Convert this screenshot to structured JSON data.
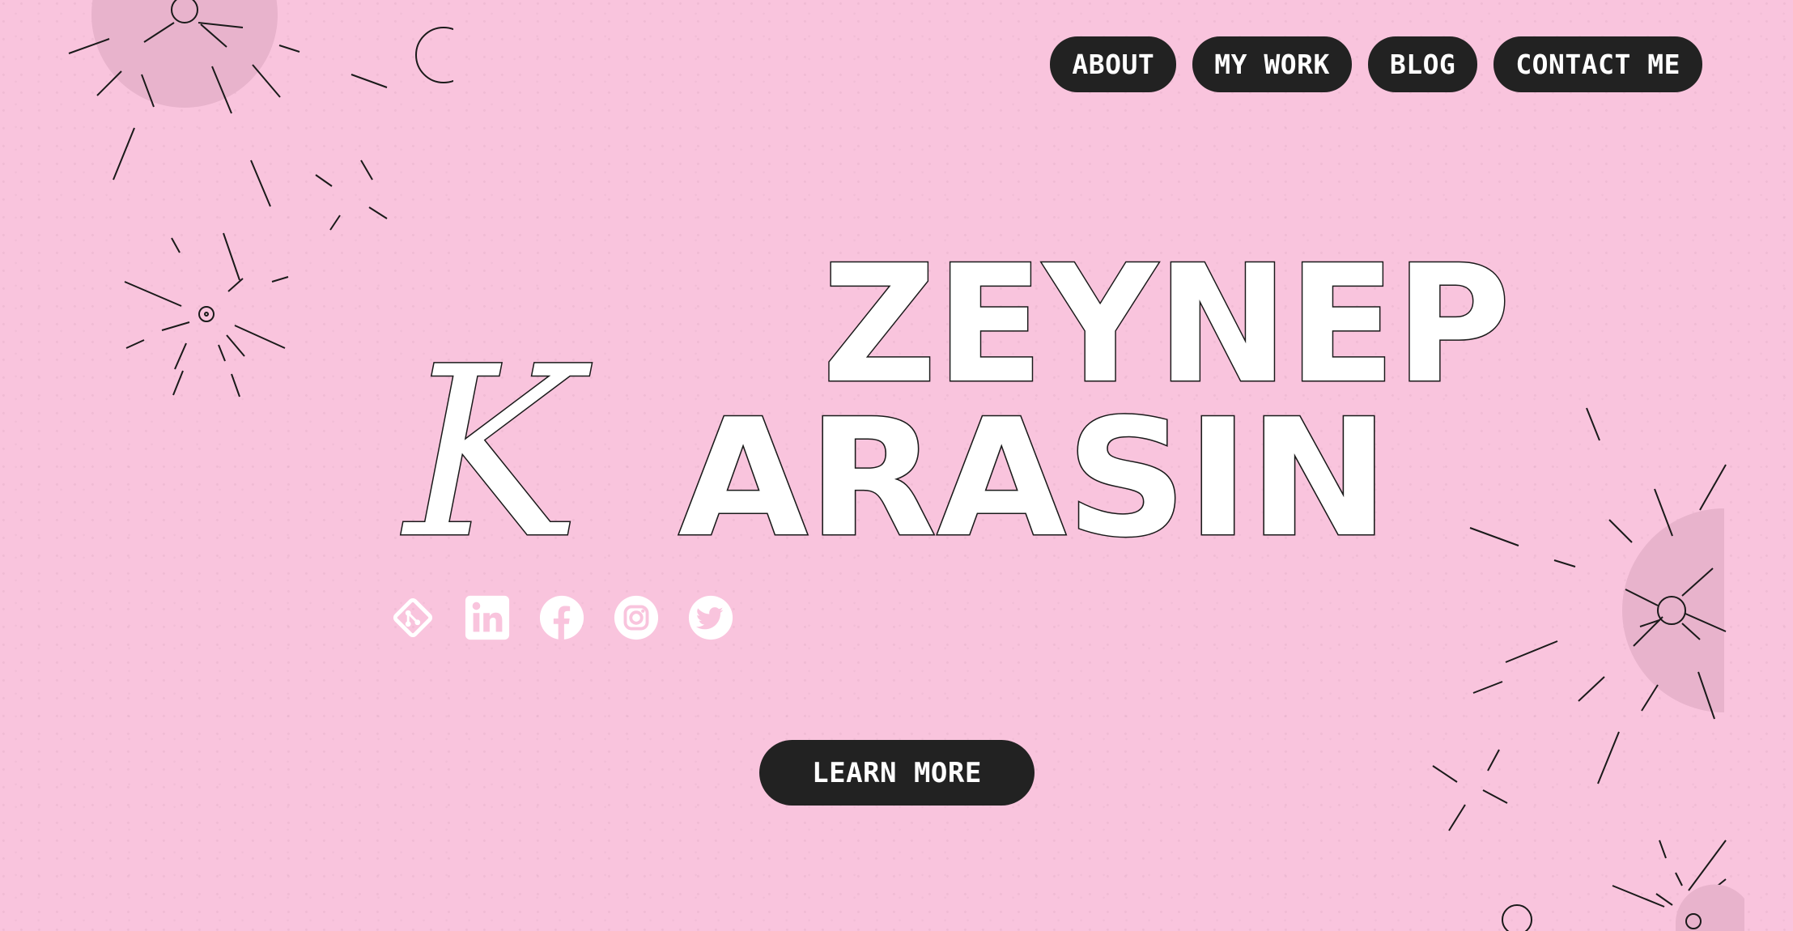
{
  "nav": {
    "items": [
      {
        "label": "ABOUT"
      },
      {
        "label": "MY WORK"
      },
      {
        "label": "BLOG"
      },
      {
        "label": "CONTACT ME"
      }
    ]
  },
  "hero": {
    "first_name": "ZEYNEP",
    "last_name_initial": "K",
    "last_name_rest": "ARASIN"
  },
  "socials": [
    {
      "icon": "git-icon"
    },
    {
      "icon": "linkedin-icon"
    },
    {
      "icon": "facebook-icon"
    },
    {
      "icon": "instagram-icon"
    },
    {
      "icon": "twitter-icon"
    }
  ],
  "cta": {
    "label": "LEARN MORE"
  },
  "colors": {
    "background": "#f9c4dd",
    "blob": "#e8b3cc",
    "dark": "#222222",
    "white": "#ffffff"
  }
}
